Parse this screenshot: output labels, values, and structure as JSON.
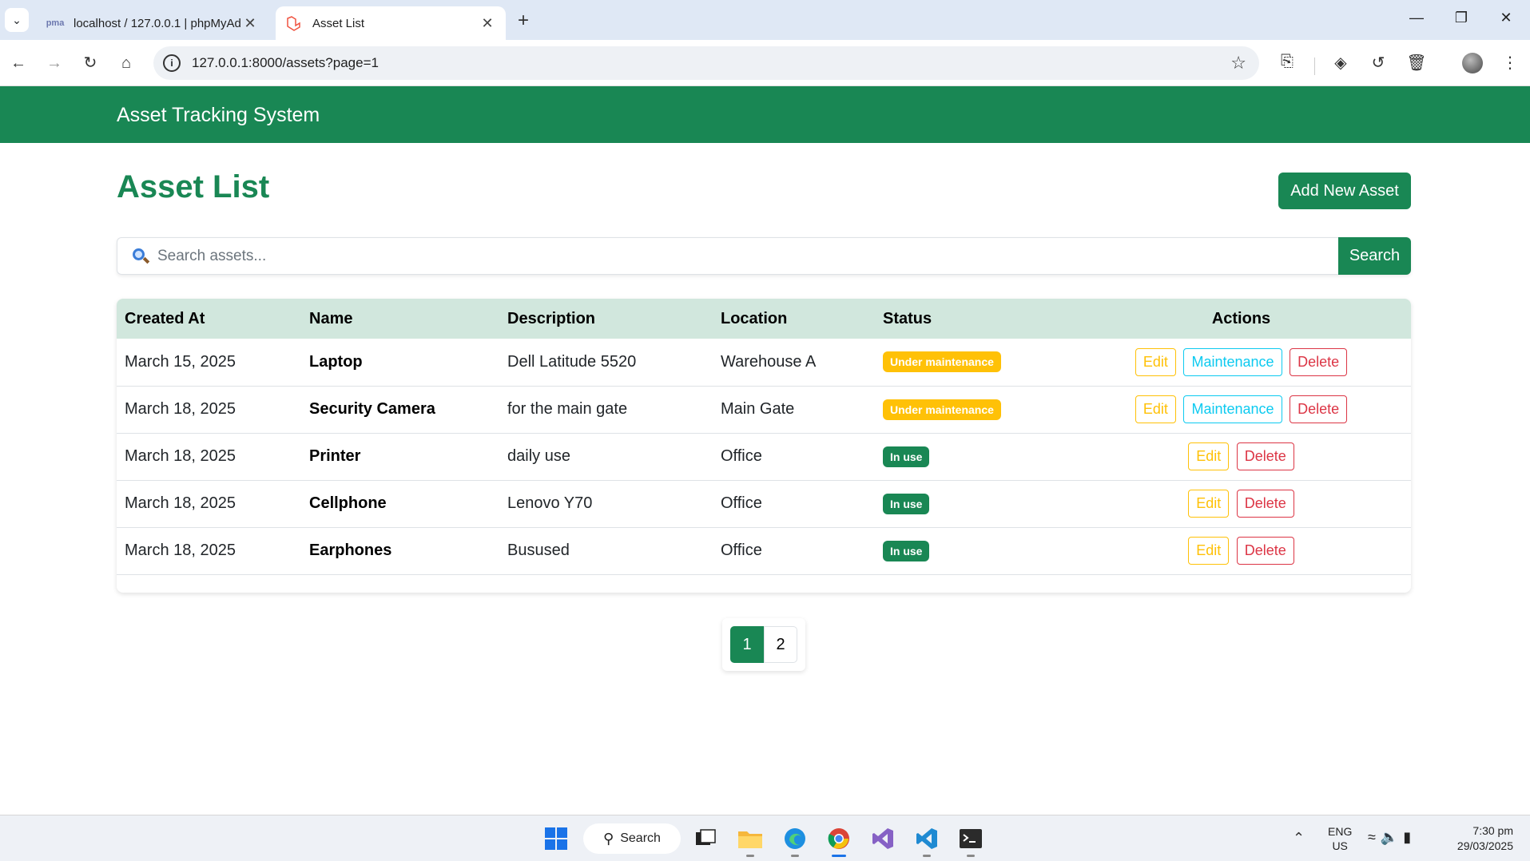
{
  "browser": {
    "tabs": [
      {
        "title": "localhost / 127.0.0.1 | phpMyAdmin",
        "favicon": "phpmyadmin-icon",
        "active": false
      },
      {
        "title": "Asset List",
        "favicon": "laravel-icon",
        "active": true
      }
    ],
    "url": "127.0.0.1:8000/assets?page=1"
  },
  "app": {
    "brand": "Asset Tracking System",
    "page_title": "Asset List",
    "add_button": "Add New Asset",
    "search": {
      "placeholder": "Search assets...",
      "value": "",
      "button": "Search"
    },
    "table": {
      "headers": {
        "created_at": "Created At",
        "name": "Name",
        "description": "Description",
        "location": "Location",
        "status": "Status",
        "actions": "Actions"
      },
      "rows": [
        {
          "created_at": "March 15, 2025",
          "name": "Laptop",
          "description": "Dell Latitude 5520",
          "location": "Warehouse A",
          "status": "Under maintenance",
          "actions": [
            "Edit",
            "Maintenance",
            "Delete"
          ]
        },
        {
          "created_at": "March 18, 2025",
          "name": "Security Camera",
          "description": "for the main gate",
          "location": "Main Gate",
          "status": "Under maintenance",
          "actions": [
            "Edit",
            "Maintenance",
            "Delete"
          ]
        },
        {
          "created_at": "March 18, 2025",
          "name": "Printer",
          "description": "daily use",
          "location": "Office",
          "status": "In use",
          "actions": [
            "Edit",
            "Delete"
          ]
        },
        {
          "created_at": "March 18, 2025",
          "name": "Cellphone",
          "description": "Lenovo Y70",
          "location": "Office",
          "status": "In use",
          "actions": [
            "Edit",
            "Delete"
          ]
        },
        {
          "created_at": "March 18, 2025",
          "name": "Earphones",
          "description": "Busused",
          "location": "Office",
          "status": "In use",
          "actions": [
            "Edit",
            "Delete"
          ]
        }
      ]
    },
    "pagination": {
      "pages": [
        "1",
        "2"
      ],
      "current": "1"
    }
  },
  "colors": {
    "primary": "#198754",
    "table_header": "#d1e7dd",
    "warning": "#ffc107",
    "info": "#0dcaf0",
    "danger": "#dc3545"
  },
  "taskbar": {
    "search_label": "Search",
    "lang_line1": "ENG",
    "lang_line2": "US",
    "time": "7:30 pm",
    "date": "29/03/2025"
  }
}
